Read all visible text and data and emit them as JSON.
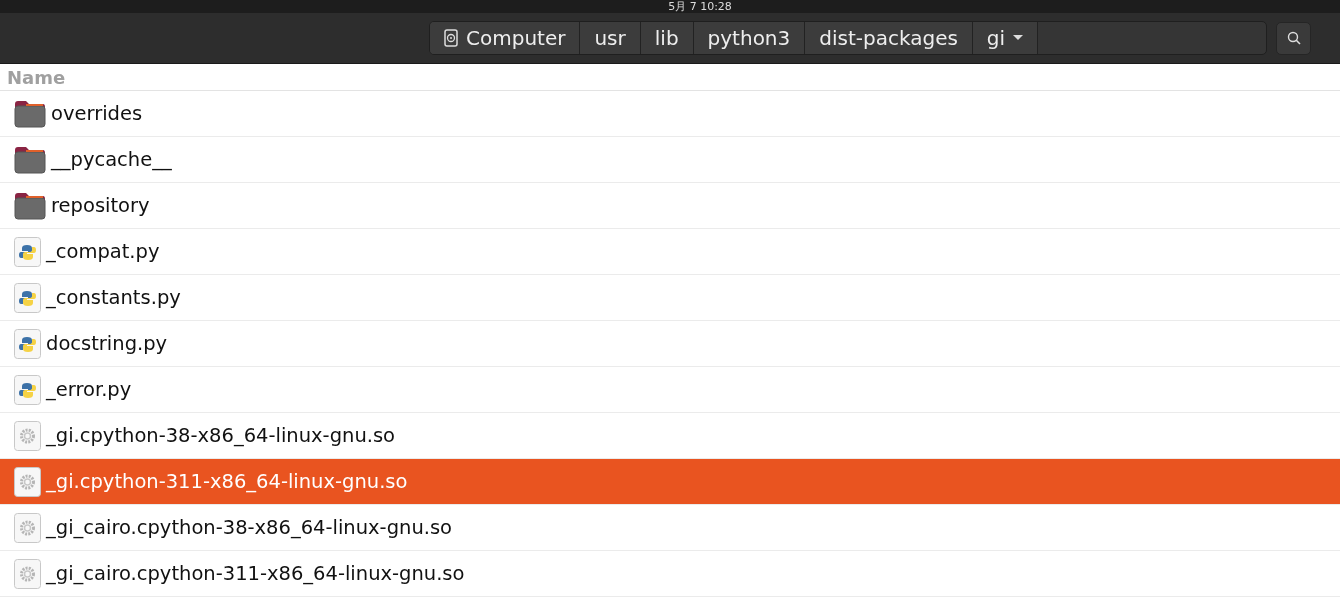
{
  "top_bar": {
    "clock": "5月 7  10:28"
  },
  "path_bar": {
    "segments": [
      {
        "label": "Computer",
        "kind": "device"
      },
      {
        "label": "usr",
        "kind": "folder"
      },
      {
        "label": "lib",
        "kind": "folder"
      },
      {
        "label": "python3",
        "kind": "folder"
      },
      {
        "label": "dist-packages",
        "kind": "folder"
      },
      {
        "label": "gi",
        "kind": "current"
      }
    ]
  },
  "table": {
    "columns": [
      "Name"
    ],
    "rows": [
      {
        "name": "overrides",
        "kind": "folder",
        "selected": false
      },
      {
        "name": "__pycache__",
        "kind": "folder",
        "selected": false
      },
      {
        "name": "repository",
        "kind": "folder",
        "selected": false
      },
      {
        "name": "_compat.py",
        "kind": "python",
        "selected": false
      },
      {
        "name": "_constants.py",
        "kind": "python",
        "selected": false
      },
      {
        "name": "docstring.py",
        "kind": "python",
        "selected": false
      },
      {
        "name": "_error.py",
        "kind": "python",
        "selected": false
      },
      {
        "name": "_gi.cpython-38-x86_64-linux-gnu.so",
        "kind": "library",
        "selected": false
      },
      {
        "name": "_gi.cpython-311-x86_64-linux-gnu.so",
        "kind": "library",
        "selected": true
      },
      {
        "name": "_gi_cairo.cpython-38-x86_64-linux-gnu.so",
        "kind": "library",
        "selected": false
      },
      {
        "name": "_gi_cairo.cpython-311-x86_64-linux-gnu.so",
        "kind": "library",
        "selected": false
      }
    ]
  }
}
